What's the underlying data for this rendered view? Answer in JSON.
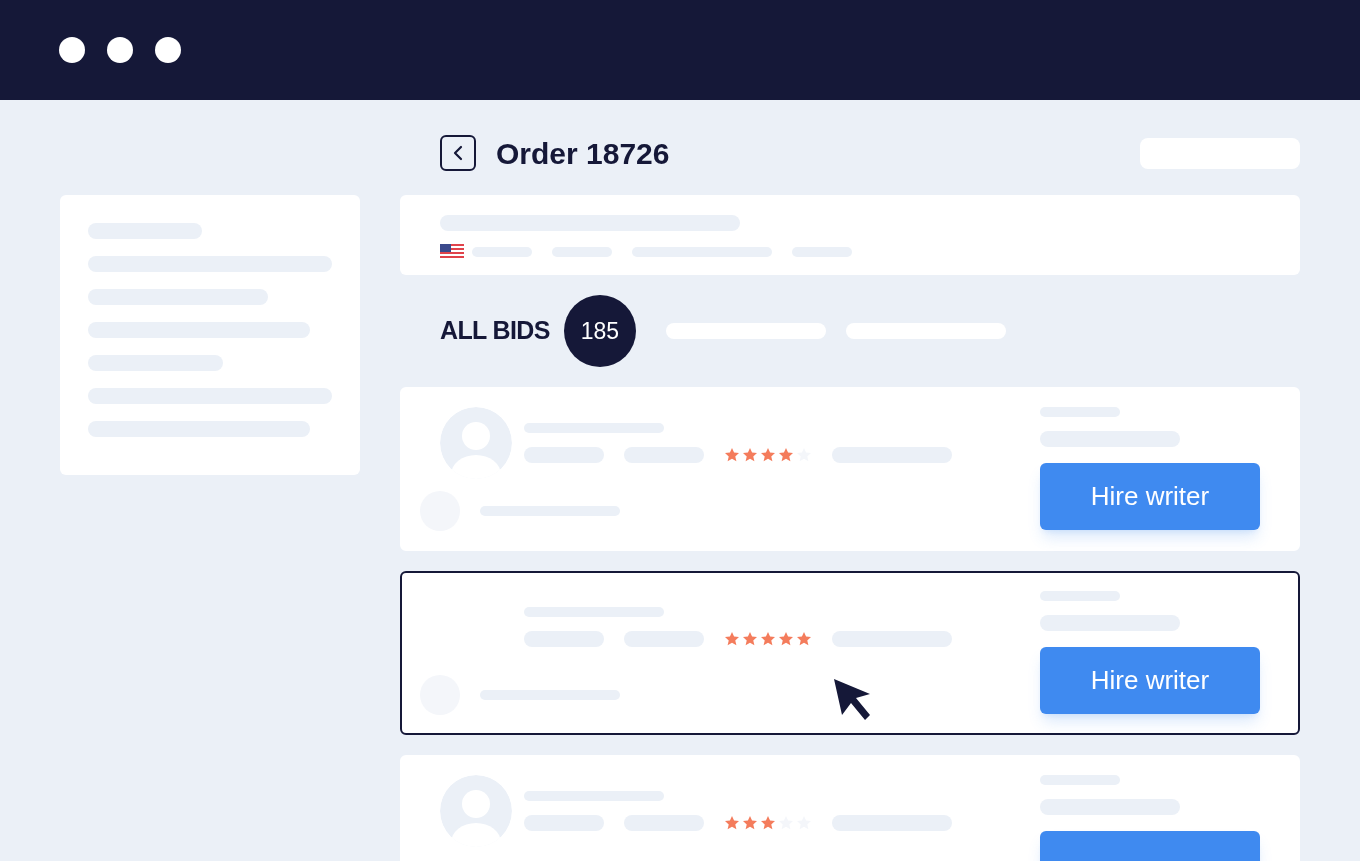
{
  "page": {
    "title": "Order 18726"
  },
  "bids_header": {
    "label": "ALL BIDS",
    "count": "185"
  },
  "bids": [
    {
      "stars": 4,
      "selected": false,
      "avatar": true,
      "button": "Hire writer"
    },
    {
      "stars": 5,
      "selected": true,
      "avatar": false,
      "button": "Hire writer"
    },
    {
      "stars": 3,
      "selected": false,
      "avatar": true
    }
  ]
}
